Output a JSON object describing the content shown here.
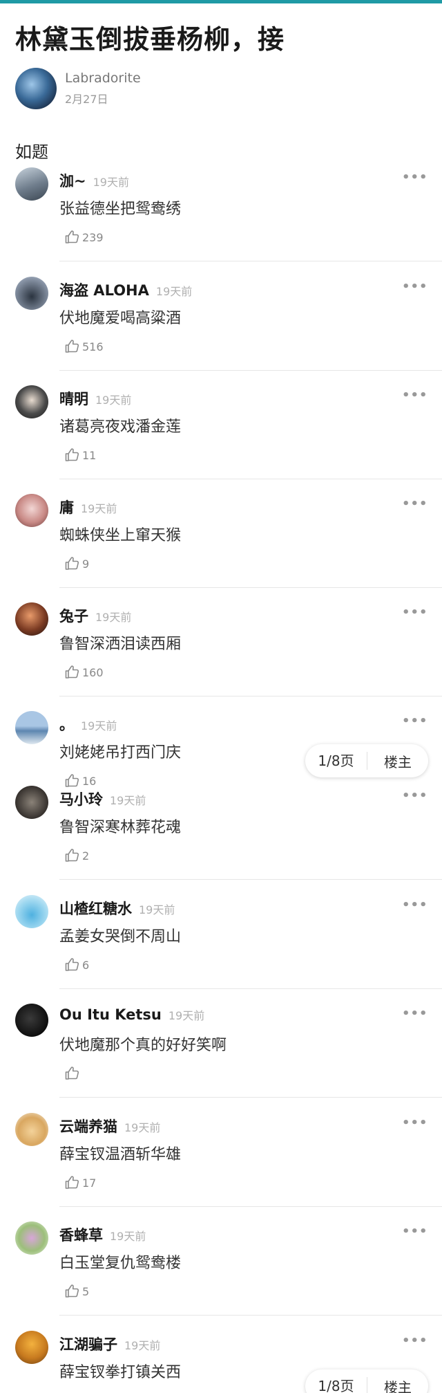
{
  "post": {
    "title": "林黛玉倒拔垂杨柳，接",
    "author": "Labradorite",
    "date": "2月27日",
    "body": "如题"
  },
  "more_label": "•••",
  "pager": {
    "page": "1/8页",
    "owner": "楼主"
  },
  "comments": [
    {
      "name": "泇~",
      "time": "19天前",
      "text": "张益德坐把鸳鸯绣",
      "likes": "239"
    },
    {
      "name": "海盗 ALOHA",
      "time": "19天前",
      "text": "伏地魔爱喝高粱酒",
      "likes": "516"
    },
    {
      "name": "晴明",
      "time": "19天前",
      "text": "诸葛亮夜戏潘金莲",
      "likes": "11"
    },
    {
      "name": "庸",
      "time": "19天前",
      "text": "蜘蛛侠坐上窜天猴",
      "likes": "9"
    },
    {
      "name": "兔子",
      "time": "19天前",
      "text": "鲁智深洒泪读西厢",
      "likes": "160"
    },
    {
      "name": "。",
      "time": "19天前",
      "text": "刘姥姥吊打西门庆",
      "likes": "16"
    },
    {
      "name": "马小玲",
      "time": "19天前",
      "text": "鲁智深寒林葬花魂",
      "likes": "2"
    },
    {
      "name": "山楂红糖水",
      "time": "19天前",
      "text": "孟姜女哭倒不周山",
      "likes": "6"
    },
    {
      "name": "Ou Itu Ketsu",
      "time": "19天前",
      "text": "伏地魔那个真的好好笑啊",
      "likes": ""
    },
    {
      "name": "云端养猫",
      "time": "19天前",
      "text": "薛宝钗温酒斩华雄",
      "likes": "17"
    },
    {
      "name": "香蜂草",
      "time": "19天前",
      "text": "白玉堂复仇鸳鸯楼",
      "likes": "5"
    },
    {
      "name": "江湖骗子",
      "time": "19天前",
      "text": "薛宝钗拳打镇关西",
      "likes": ""
    }
  ]
}
